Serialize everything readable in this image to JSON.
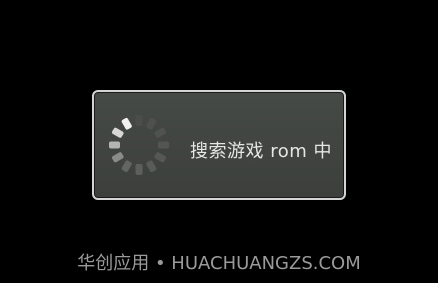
{
  "dialog": {
    "message": "搜索游戏 rom 中",
    "spinner_icon": "loading-spinner-icon"
  },
  "watermark": {
    "text": "华创应用 • HUACHUANGZS.COM"
  },
  "colors": {
    "background": "#000000",
    "dialog_bg": "#414441",
    "dialog_border": "#d4d4d4",
    "text": "#e6e6e6",
    "watermark": "#9a9a9a"
  }
}
